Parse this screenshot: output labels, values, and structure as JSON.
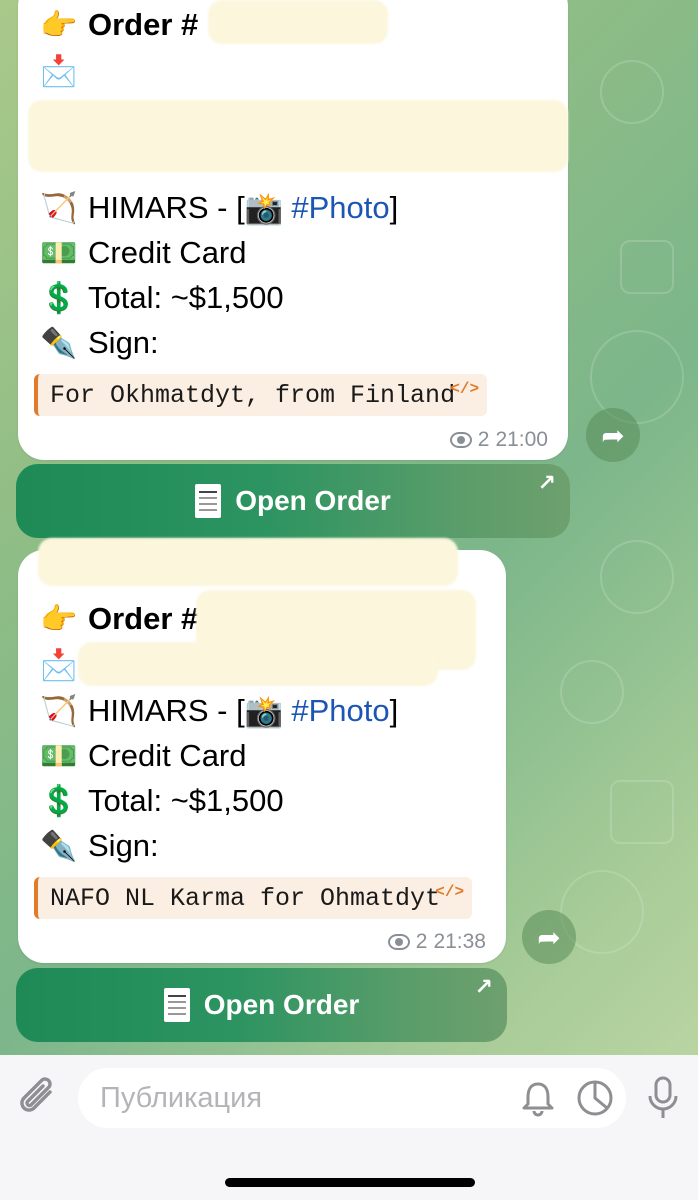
{
  "messages": [
    {
      "order_label": "Order #",
      "item": "HIMARS - [",
      "photo_tag": "#Photo",
      "item_close": "]",
      "payment": "Credit Card",
      "total": "Total: ~$1,500",
      "sign": "Sign:",
      "quote": "For Okhmatdyt, from Finland",
      "views": "2",
      "time": "21:00",
      "button": "Open Order"
    },
    {
      "order_label": "Order #",
      "item": "HIMARS - [",
      "photo_tag": "#Photo",
      "item_close": "]",
      "payment": "Credit Card",
      "total": "Total: ~$1,500",
      "sign": "Sign:",
      "quote": "NAFO NL Karma for Ohmatdyt",
      "views": "2",
      "time": "21:38",
      "button": "Open Order"
    }
  ],
  "icons": {
    "pointer": "👉",
    "envelope": "📩",
    "bow": "🏹",
    "camera": "📸",
    "money": "💵",
    "dollar": "💲",
    "pen": "✒️"
  },
  "composer": {
    "placeholder": "Публикация"
  },
  "colors": {
    "link": "#1c56b5",
    "button": "#2c9461",
    "quote_bar": "#e07b2c"
  }
}
